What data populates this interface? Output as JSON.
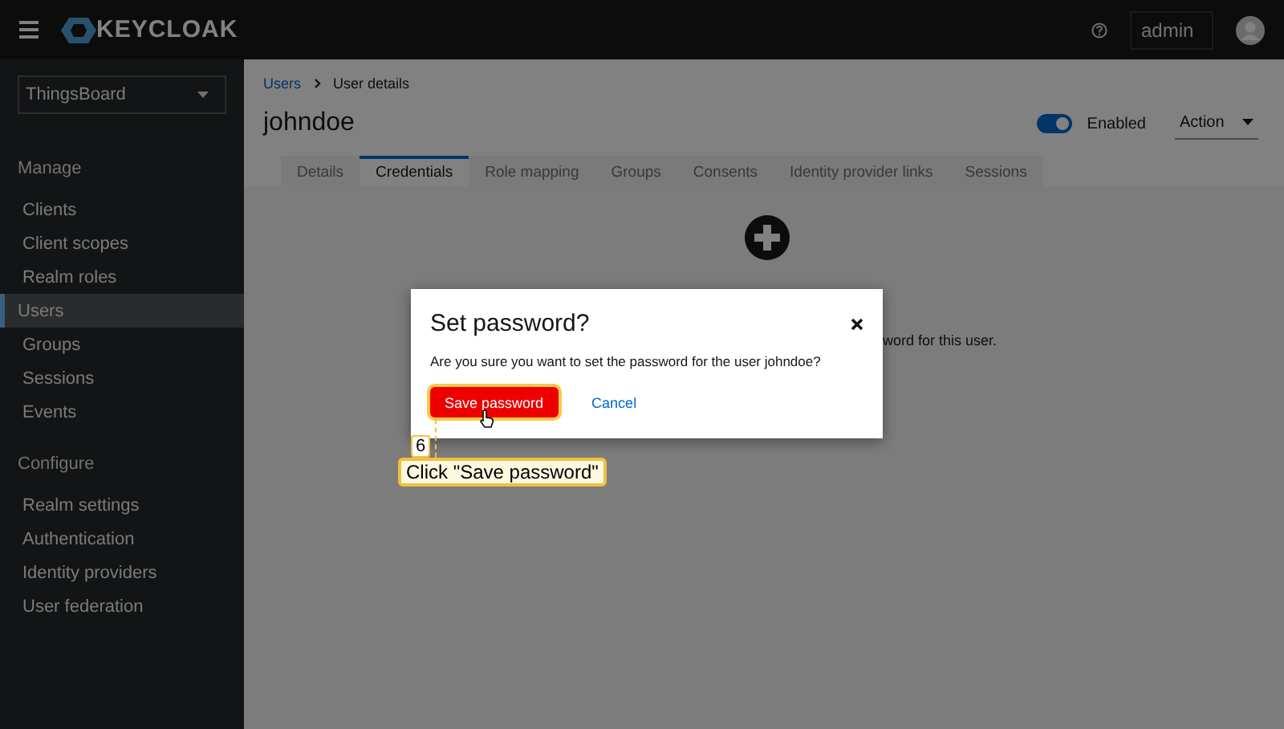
{
  "header": {
    "logo": "KEYCLOAK",
    "user": "admin"
  },
  "sidebar": {
    "realm": "ThingsBoard",
    "sections": [
      {
        "title": "Manage",
        "items": [
          {
            "label": "Clients",
            "selected": false
          },
          {
            "label": "Client scopes",
            "selected": false
          },
          {
            "label": "Realm roles",
            "selected": false
          },
          {
            "label": "Users",
            "selected": true
          },
          {
            "label": "Groups",
            "selected": false
          },
          {
            "label": "Sessions",
            "selected": false
          },
          {
            "label": "Events",
            "selected": false
          }
        ]
      },
      {
        "title": "Configure",
        "items": [
          {
            "label": "Realm settings",
            "selected": false
          },
          {
            "label": "Authentication",
            "selected": false
          },
          {
            "label": "Identity providers",
            "selected": false
          },
          {
            "label": "User federation",
            "selected": false
          }
        ]
      }
    ]
  },
  "breadcrumb": [
    "Users",
    "User details"
  ],
  "page": {
    "title": "johndoe",
    "enabled": {
      "label": "Enabled",
      "on": true
    },
    "action": "Action"
  },
  "tabs": [
    {
      "label": "Details",
      "selected": false
    },
    {
      "label": "Credentials",
      "selected": true
    },
    {
      "label": "Role mapping",
      "selected": false
    },
    {
      "label": "Groups",
      "selected": false
    },
    {
      "label": "Consents",
      "selected": false
    },
    {
      "label": "Identity provider links",
      "selected": false
    },
    {
      "label": "Sessions",
      "selected": false
    }
  ],
  "empty_state": {
    "text": "word for this user."
  },
  "dialog": {
    "title": "Set password?",
    "message": "Are you sure you want to set the password for the user johndoe?",
    "buttons": [
      {
        "label": "Save password",
        "kind": "primary"
      },
      {
        "label": "Cancel",
        "kind": "link"
      }
    ]
  },
  "annotation": {
    "step": "6",
    "text": "Click \"Save password\""
  }
}
